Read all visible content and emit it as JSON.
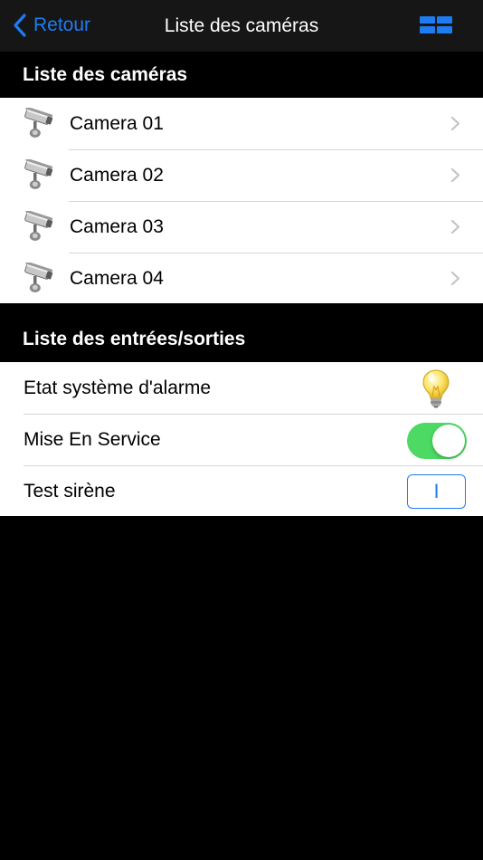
{
  "navbar": {
    "back_label": "Retour",
    "title": "Liste des caméras",
    "back_icon": "chevron-left-icon",
    "grid_icon": "grid-view-icon"
  },
  "cameras_section": {
    "header": "Liste des caméras",
    "items": [
      {
        "label": "Camera 01",
        "icon": "security-camera-icon"
      },
      {
        "label": "Camera 02",
        "icon": "security-camera-icon"
      },
      {
        "label": "Camera 03",
        "icon": "security-camera-icon"
      },
      {
        "label": "Camera 04",
        "icon": "security-camera-icon"
      }
    ]
  },
  "io_section": {
    "header": "Liste des entrées/sorties",
    "alarm_state": {
      "label": "Etat système d'alarme",
      "icon": "lightbulb-icon"
    },
    "mise_en_service": {
      "label": "Mise En Service",
      "toggle_on": true
    },
    "test_siren": {
      "label": "Test sirène",
      "button_label": "I"
    }
  },
  "colors": {
    "accent": "#1e7cf2",
    "toggle_on": "#4cd964",
    "navbar_bg": "#161616",
    "background": "#000000"
  }
}
